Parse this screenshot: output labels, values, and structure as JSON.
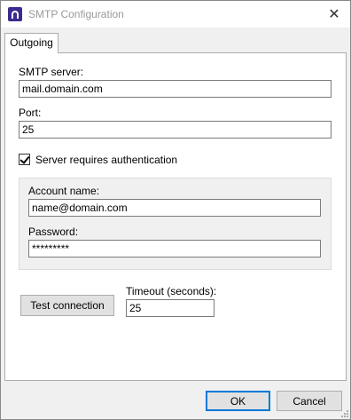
{
  "window": {
    "title": "SMTP Configuration"
  },
  "tabs": [
    {
      "label": "Outgoing",
      "selected": true
    }
  ],
  "smtp_server": {
    "label": "SMTP server:",
    "value": "mail.domain.com"
  },
  "port": {
    "label": "Port:",
    "value": "25"
  },
  "auth": {
    "label": "Server requires authentication",
    "checked": true
  },
  "account_name": {
    "label": "Account name:",
    "value": "name@domain.com"
  },
  "password": {
    "label": "Password:",
    "value": "*********"
  },
  "test_button": {
    "label": "Test connection"
  },
  "timeout": {
    "label": "Timeout (seconds):",
    "value": "25"
  },
  "footer": {
    "ok_label": "OK",
    "cancel_label": "Cancel"
  },
  "colors": {
    "accent": "#0078d7",
    "icon": "#3b2a8f"
  },
  "icons": {
    "app": "app-icon",
    "close": "close-icon"
  }
}
